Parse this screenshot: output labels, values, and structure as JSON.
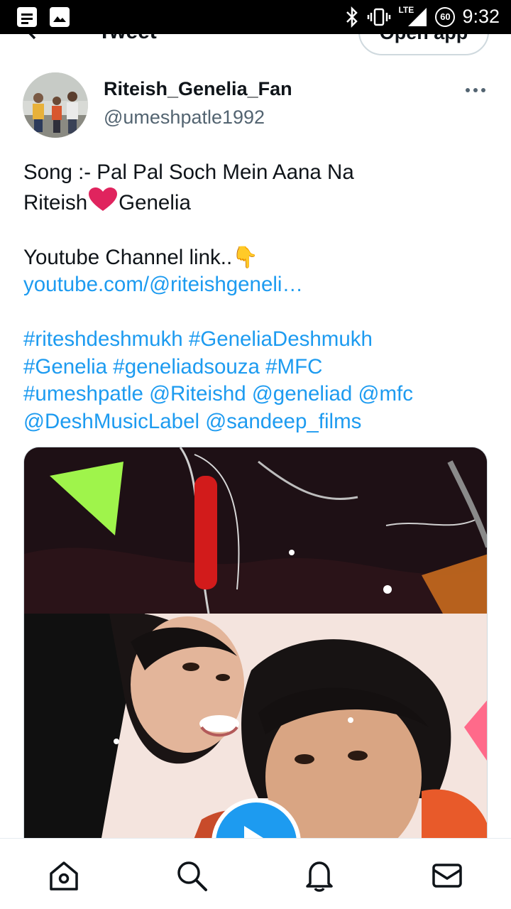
{
  "status_bar": {
    "time": "9:32",
    "network": "LTE",
    "battery": "60",
    "icons": [
      "notes-icon",
      "gallery-icon",
      "bluetooth-icon",
      "vibrate-icon",
      "signal-icon",
      "battery-icon"
    ]
  },
  "header": {
    "title": "Tweet",
    "open_app_label": "Open app"
  },
  "author": {
    "name": "Riteish_Genelia_Fan",
    "handle": "@umeshpatle1992"
  },
  "tweet": {
    "line1": "Song :- Pal Pal Soch Mein Aana Na",
    "line2_a": "Riteish",
    "line2_b": "Genelia",
    "line3": "Youtube Channel link..",
    "pointing_emoji": "👇",
    "link": "youtube.com/@riteishgeneli…",
    "tags_line1": "#riteshdeshmukh #GeneliaDeshmukh",
    "tags_line2": "#Genelia #geneliadsouza #MFC",
    "tags_line3": "#umeshpatle @Riteishd @geneliad @mfc",
    "tags_line4": "@DeshMusicLabel @sandeep_films"
  },
  "media": {
    "type": "video",
    "play_icon": "play-icon"
  },
  "bottom_nav": [
    "home-icon",
    "search-icon",
    "notifications-icon",
    "messages-icon"
  ],
  "colors": {
    "accent": "#1d9bf0",
    "text": "#0f1419",
    "secondary": "#536471",
    "heart": "#e0245e"
  }
}
